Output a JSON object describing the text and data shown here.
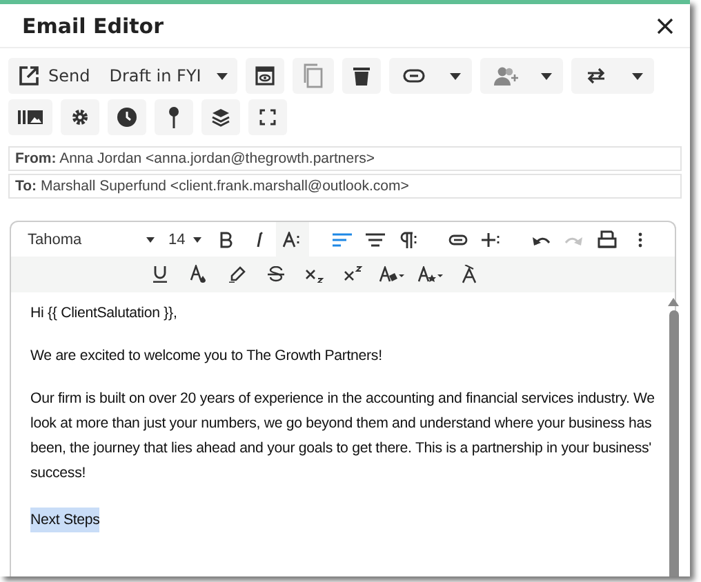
{
  "window": {
    "title": "Email Editor"
  },
  "toolbar": {
    "send_label": "Send",
    "draft_label": "Draft in FYI"
  },
  "from": {
    "label": "From:",
    "value": "Anna Jordan <anna.jordan@thegrowth.partners>"
  },
  "to": {
    "label": "To:",
    "value": "Marshall Superfund <client.frank.marshall@outlook.com>"
  },
  "editor_toolbar": {
    "font": "Tahoma",
    "size": "14",
    "align_left_selected": true,
    "redo_disabled": true
  },
  "body": [
    {
      "text": "Hi {{ ClientSalutation }},",
      "highlighted": false
    },
    {
      "text": "We are excited to welcome you to The Growth Partners!",
      "highlighted": false
    },
    {
      "text": "Our firm is built on over 20 years of experience in the accounting and financial services industry. We look at more than just your numbers, we go beyond them and understand where your business has been, the journey that lies ahead and your goals to get there. This is a partnership in your business' success!",
      "highlighted": false
    },
    {
      "text": "Next Steps",
      "highlighted": true
    }
  ]
}
